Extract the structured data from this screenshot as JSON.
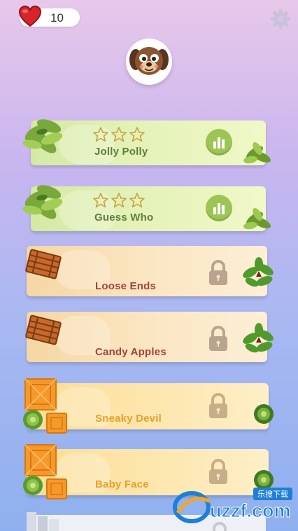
{
  "status": {
    "lives_count": "10",
    "icons": [
      "heart-icon",
      "gear-icon"
    ],
    "colors": {
      "heart": "#d8242b",
      "gear": "#c9c2d8"
    }
  },
  "avatar": {
    "icon": "puppy-face-icon"
  },
  "levels": [
    {
      "title": "Jolly Polly",
      "state": "unlocked",
      "stars": 0,
      "theme": "green"
    },
    {
      "title": "Guess Who",
      "state": "unlocked",
      "stars": 0,
      "theme": "green"
    },
    {
      "title": "Loose Ends",
      "state": "locked",
      "theme": "peach"
    },
    {
      "title": "Candy Apples",
      "state": "locked",
      "theme": "peach"
    },
    {
      "title": "Sneaky Devil",
      "state": "locked",
      "theme": "orange"
    },
    {
      "title": "Baby Face",
      "state": "locked",
      "theme": "orange"
    }
  ],
  "watermark": {
    "cn_text": "乐搜下载",
    "domain": "uzzf.com"
  }
}
